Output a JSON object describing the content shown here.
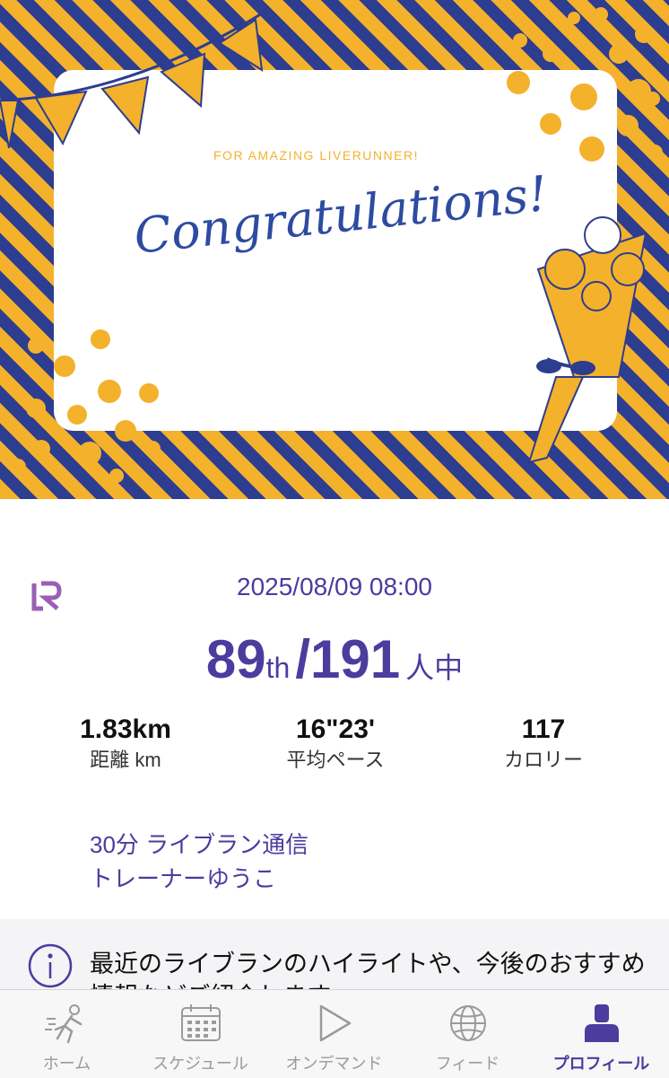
{
  "card": {
    "subtitle": "FOR  AMAZING LIVERUNNER!",
    "title": "Congratulations!",
    "colors": {
      "yellow": "#f3b12c",
      "blue": "#2d3d8f"
    }
  },
  "result": {
    "datetime": "2025/08/09 08:00",
    "rank": "89",
    "rank_suffix": "th",
    "total": "/191",
    "total_unit": "人中",
    "stats": [
      {
        "value": "1.83km",
        "label": "距離 km"
      },
      {
        "value": "16\"23'",
        "label": "平均ペース"
      },
      {
        "value": "117",
        "label": "カロリー"
      }
    ]
  },
  "program": {
    "title": "30分 ライブラン通信",
    "trainer": "トレーナーゆうこ"
  },
  "info": {
    "icon": "info-icon",
    "text": "最近のライブランのハイライトや、今後のおすすめ情報などご紹介します"
  },
  "tabs": [
    {
      "label": "ホーム",
      "icon": "runner-icon",
      "active": false
    },
    {
      "label": "スケジュール",
      "icon": "calendar-icon",
      "active": false
    },
    {
      "label": "オンデマンド",
      "icon": "play-icon",
      "active": false
    },
    {
      "label": "フィード",
      "icon": "globe-icon",
      "active": false
    },
    {
      "label": "プロフィール",
      "icon": "profile-icon",
      "active": true
    }
  ],
  "accent_color": "#4b3c9e"
}
